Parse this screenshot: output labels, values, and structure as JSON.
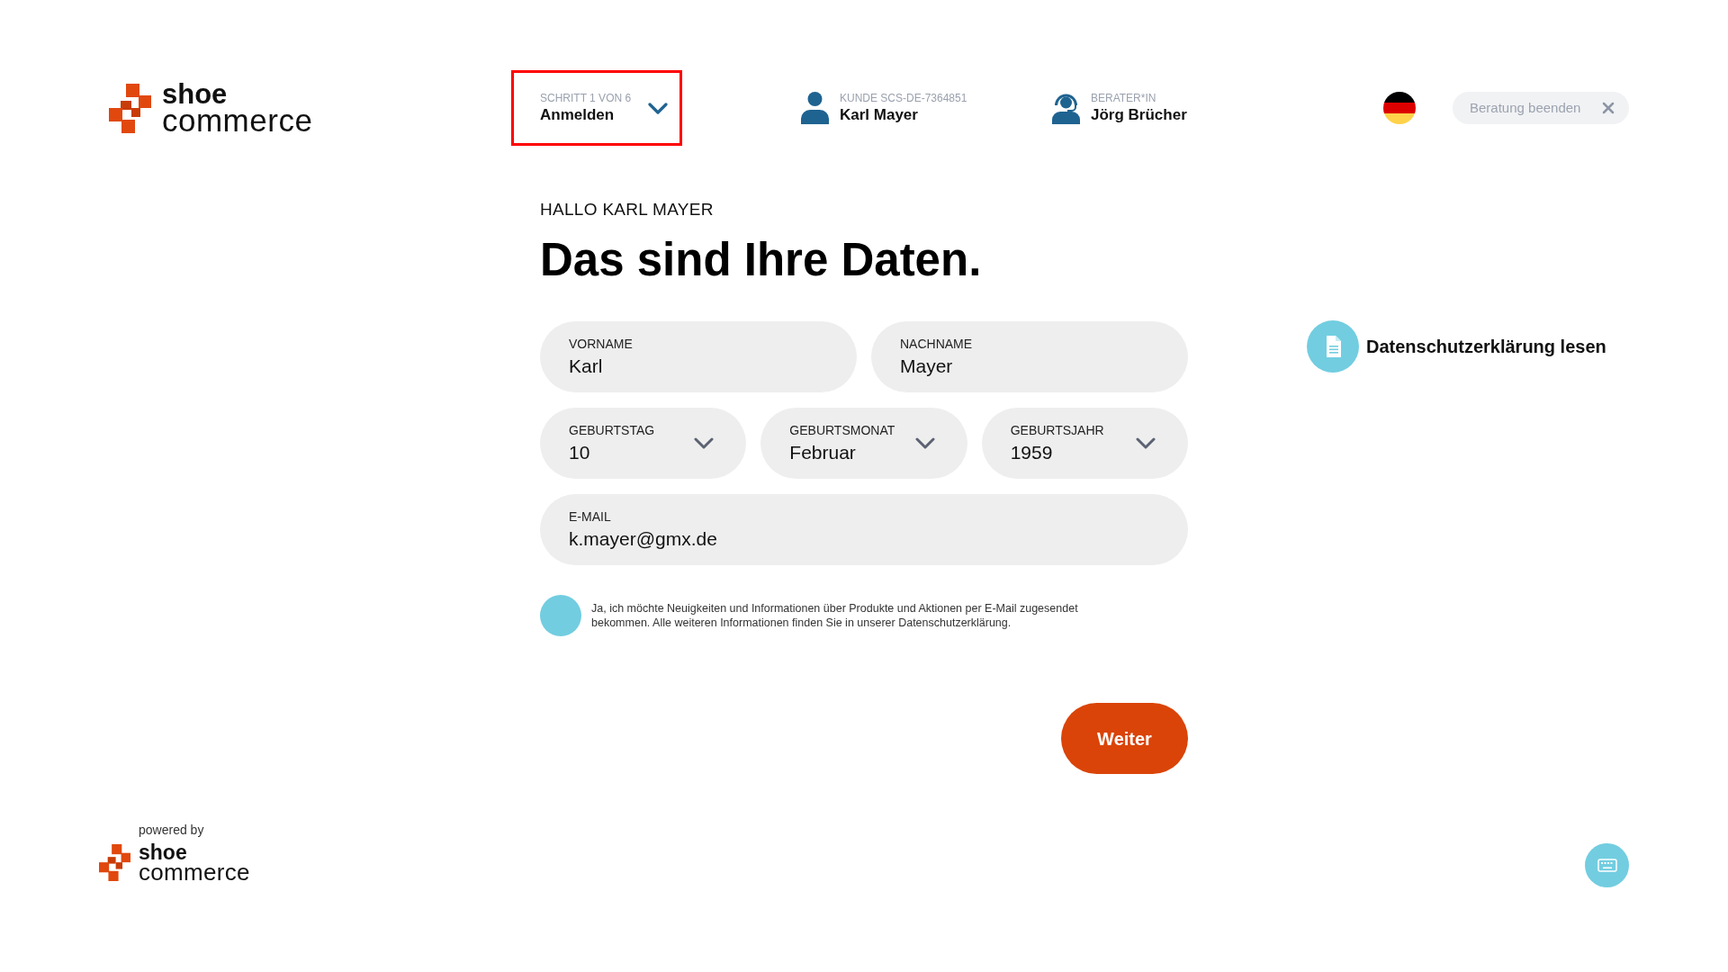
{
  "header": {
    "logo": {
      "wordmark": [
        "shoe",
        "commerce"
      ]
    },
    "step": {
      "caption": "SCHRITT 1 VON 6",
      "label": "Anmelden",
      "highlighted": true
    },
    "customer": {
      "caption": "KUNDE SCS-DE-7364851",
      "name": "Karl Mayer"
    },
    "advisor": {
      "caption": "BERATER*IN",
      "name": "Jörg Brücher"
    },
    "end_button": {
      "label": "Beratung beenden"
    }
  },
  "greeting": "HALLO KARL MAYER",
  "heading": "Das sind Ihre Daten.",
  "form": {
    "rows": [
      {
        "fields": [
          {
            "kind": "text",
            "label": "VORNAME",
            "value": "Karl"
          },
          {
            "kind": "text",
            "label": "NACHNAME",
            "value": "Mayer"
          }
        ]
      },
      {
        "fields": [
          {
            "kind": "select",
            "label": "GEBURTSTAG",
            "value": "10"
          },
          {
            "kind": "select",
            "label": "GEBURTSMONAT",
            "value": "Februar"
          },
          {
            "kind": "select",
            "label": "GEBURTSJAHR",
            "value": "1959"
          }
        ]
      },
      {
        "fields": [
          {
            "kind": "text",
            "label": "E-MAIL",
            "value": "k.mayer@gmx.de"
          }
        ]
      }
    ]
  },
  "newsletter": {
    "checked": false,
    "text": "Ja, ich möchte Neuigkeiten und Informationen über Produkte und Aktionen per E-Mail zugesendet bekommen. Alle weiteren Informationen finden Sie in unserer Datenschutzerklärung."
  },
  "next_button": {
    "label": "Weiter"
  },
  "privacy_link": {
    "label": "Datenschutzerklärung lesen"
  },
  "footer": {
    "powered_by": "powered by",
    "logo": {
      "wordmark": [
        "shoe",
        "commerce"
      ]
    }
  }
}
